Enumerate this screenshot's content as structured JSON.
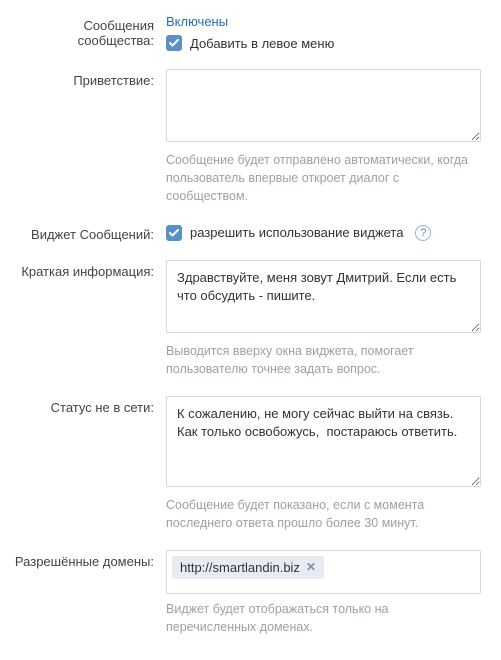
{
  "messages": {
    "label": "Сообщения сообщества:",
    "value": "Включены",
    "addToLeftMenu": "Добавить в левое меню"
  },
  "greeting": {
    "label": "Приветствие:",
    "value": "",
    "hint": "Сообщение будет отправлено автоматически, когда пользователь впервые откроет диалог с сообществом."
  },
  "widget": {
    "label": "Виджет Сообщений:",
    "allowText": "разрешить использование виджета",
    "help": "?"
  },
  "shortInfo": {
    "label": "Краткая информация:",
    "value": "Здравствуйте, меня зовут Дмитрий. Если есть что обсудить - пишите.",
    "hint": "Выводится вверху окна виджета, помогает пользователю точнее задать вопрос."
  },
  "offline": {
    "label": "Статус не в сети:",
    "value": "К сожалению, не могу сейчас выйти на связь. Как только освобожусь,  постараюсь ответить.",
    "hint": "Сообщение будет показано, если с момента последнего ответа прошло более 30 минут."
  },
  "domains": {
    "label": "Разрешённые домены:",
    "tag": "http://smartlandin.biz",
    "hint": "Виджет будет отображаться только на перечисленных доменах."
  }
}
